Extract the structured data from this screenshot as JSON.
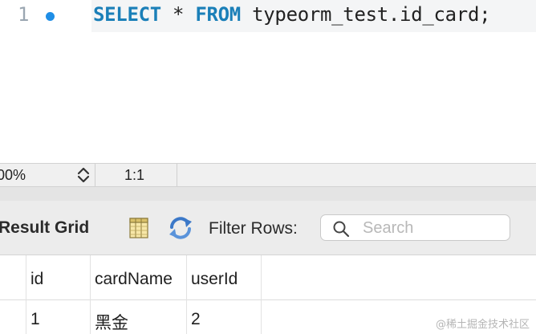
{
  "editor": {
    "line_number": "1",
    "code": {
      "kw_select": "SELECT",
      "star": " * ",
      "kw_from": "FROM",
      "rest": " typeorm_test.id_card;"
    }
  },
  "status_bar": {
    "zoom": "00%",
    "cursor_position": "1:1"
  },
  "toolbar": {
    "result_grid_label": "Result Grid",
    "filter_rows_label": "Filter Rows:",
    "search_placeholder": "Search"
  },
  "grid": {
    "columns": [
      "id",
      "cardName",
      "userId"
    ],
    "rows": [
      [
        "1",
        "黑金",
        "2"
      ]
    ]
  },
  "watermark": "@稀土掘金技术社区",
  "colors": {
    "keyword": "#1a7fb8",
    "breakpoint_dot": "#1f8ee6",
    "toolbar_bg": "#ececec"
  },
  "icons": [
    "breakpoint-dot",
    "stepper-icon",
    "grid-view-icon",
    "refresh-icon",
    "search-icon"
  ]
}
